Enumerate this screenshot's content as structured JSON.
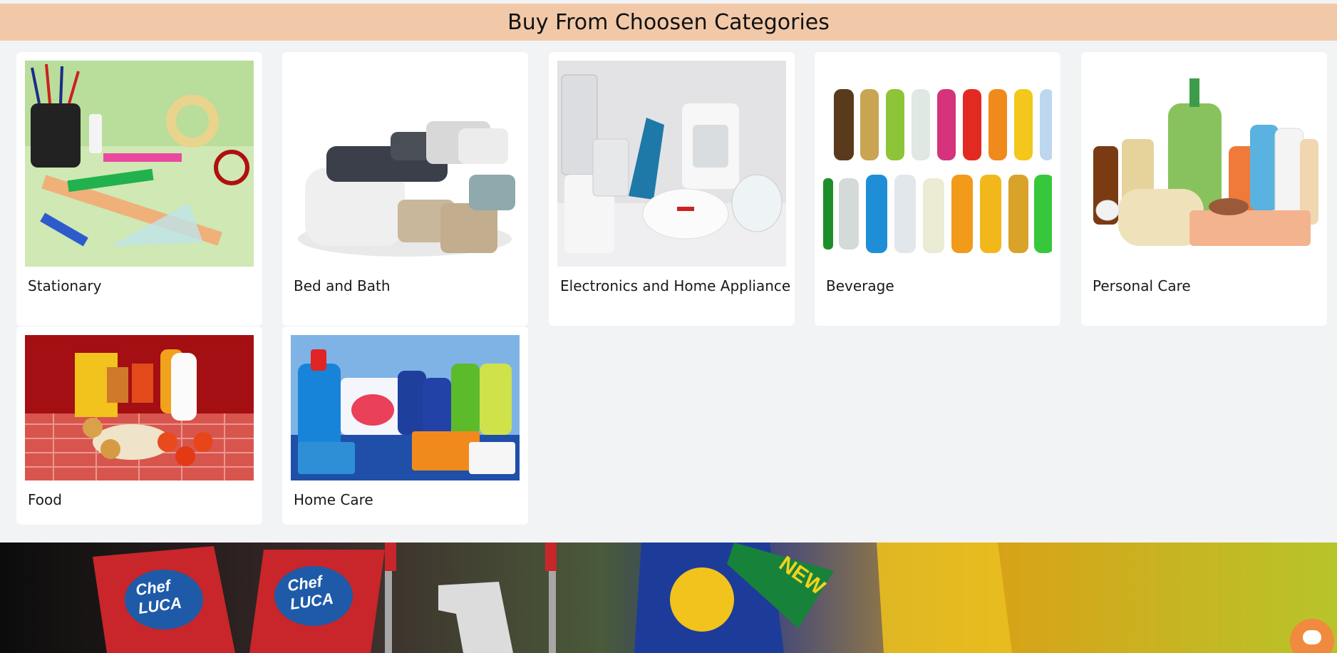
{
  "header": {
    "title": "Buy From Choosen Categories"
  },
  "categories": [
    {
      "label": "Stationary",
      "icon": "stationary-image"
    },
    {
      "label": "Bed and Bath",
      "icon": "bed-and-bath-image"
    },
    {
      "label": "Electronics and Home Appliance",
      "icon": "electronics-image"
    },
    {
      "label": "Beverage",
      "icon": "beverage-image"
    },
    {
      "label": "Personal Care",
      "icon": "personal-care-image"
    },
    {
      "label": "Food",
      "icon": "food-image"
    },
    {
      "label": "Home Care",
      "icon": "home-care-image"
    }
  ],
  "banner": {
    "logos": [
      "Chef",
      "LUCA",
      "Chef",
      "LUCA"
    ],
    "badge": "NEW"
  },
  "colors": {
    "header_bg": "#f1c9a9",
    "page_bg": "#f2f3f5",
    "chat_button": "#f08a3e"
  }
}
